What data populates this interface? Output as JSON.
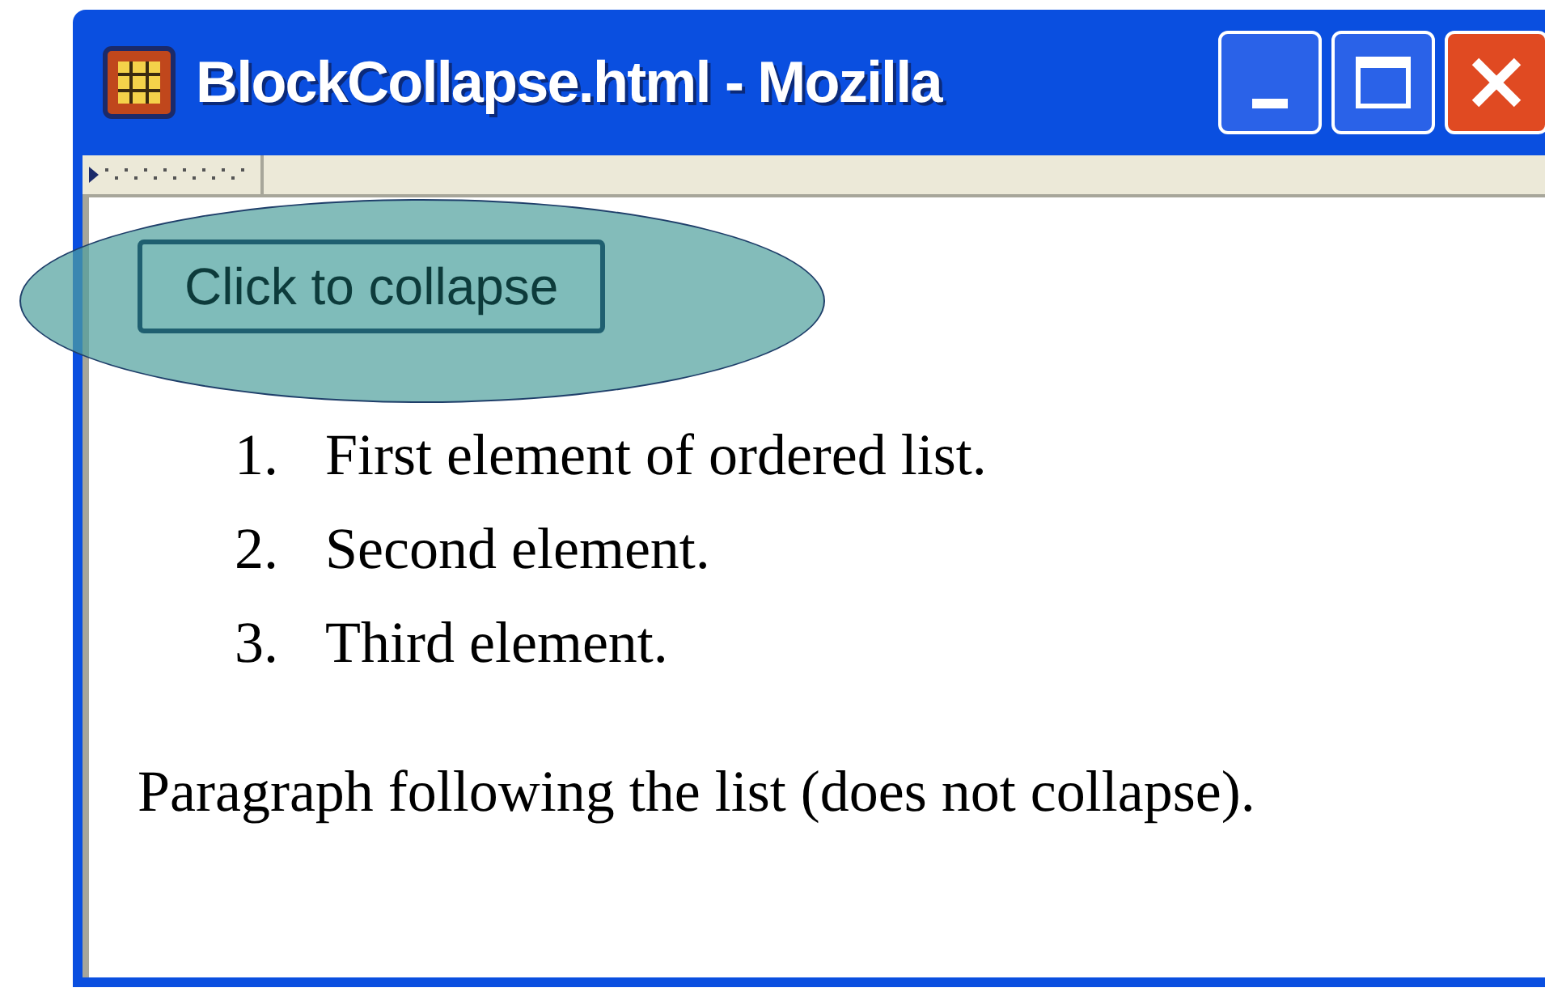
{
  "window": {
    "title": "BlockCollapse.html - Mozilla"
  },
  "page": {
    "button": "Click to collapse",
    "highlighted": true,
    "list": [
      {
        "number": "1.",
        "text": "First element of ordered list."
      },
      {
        "number": "2.",
        "text": "Second element."
      },
      {
        "number": "3.",
        "text": "Third element."
      }
    ],
    "paragraph": "Paragraph following the list (does not collapse)."
  }
}
